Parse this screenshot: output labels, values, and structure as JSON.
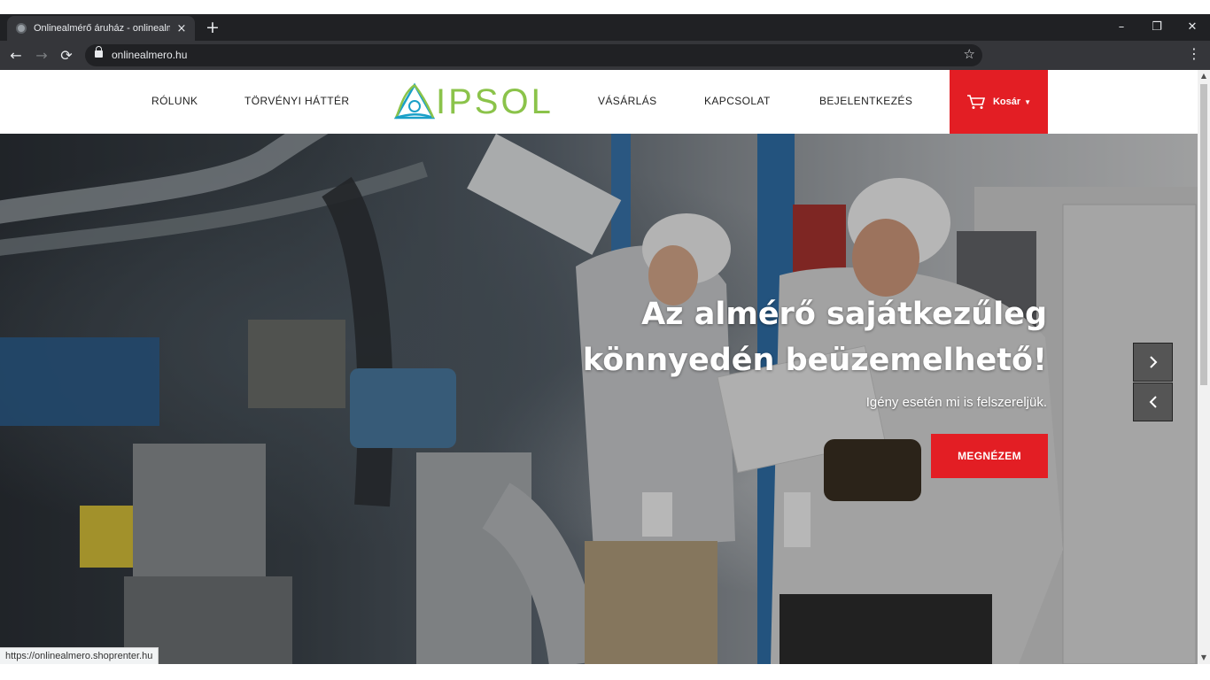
{
  "browser": {
    "tab_title": "Onlinealmérő áruház - onlinealm",
    "tab_close": "×",
    "new_tab": "+",
    "url": "onlinealmero.hu",
    "status_url": "https://onlinealmero.shoprenter.hu",
    "window_controls": {
      "minimize": "–",
      "restore": "❐",
      "close": "✕"
    },
    "nav": {
      "back": "←",
      "forward": "→",
      "reload": "⟳"
    }
  },
  "header": {
    "nav_left": [
      "RÓLUNK",
      "TÖRVÉNYI HÁTTÉR"
    ],
    "logo_text": "IPSOL",
    "nav_right": [
      "VÁSÁRLÁS",
      "KAPCSOLAT",
      "BEJELENTKEZÉS"
    ],
    "cart_label": "Kosár",
    "accent_color": "#e31e24",
    "logo_color": "#8bc34a"
  },
  "hero": {
    "title_line1": "Az almérő sajátkezűleg",
    "title_line2": "könnyedén beüzemelhető!",
    "subtitle": "Igény esetén mi is felszereljük.",
    "button_label": "MEGNÉZEM"
  }
}
